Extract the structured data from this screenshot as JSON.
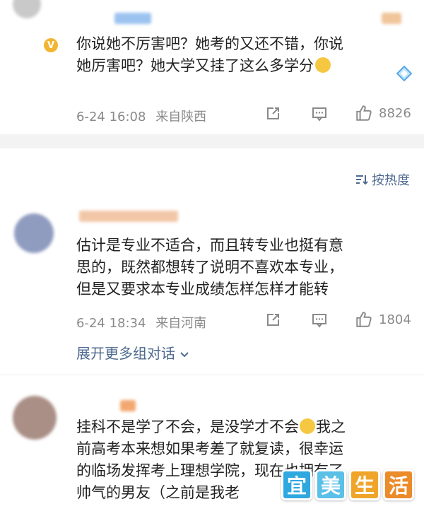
{
  "comments": [
    {
      "lines": [
        "你说她不厉害吧？她考的又还不错，你说",
        "她厉害吧？她大学又挂了这么多学分"
      ],
      "time": "6-24 16:08",
      "location": "来自陕西",
      "likes": "8826"
    },
    {
      "lines": [
        "估计是专业不适合，而且转专业也挺有意",
        "思的，既然都想转了说明不喜欢本专业，",
        "但是又要求本专业成绩怎样怎样才能转"
      ],
      "time": "6-24 18:34",
      "location": "来自河南",
      "likes": "1804",
      "expand": "展开更多组对话"
    },
    {
      "lines": [
        "挂科不是学了不会，是没学才不会",
        "前高考本来想如果考差了就复读，很幸运",
        "的临场发挥考上理想学院，现在也拥有了",
        "帅气的男友（之前是我老"
      ],
      "line1_tail": "我之"
    }
  ],
  "sort": {
    "label": "按热度"
  },
  "watermark": {
    "chars": [
      "宜",
      "美",
      "生",
      "活"
    ]
  },
  "colors": {
    "link": "#4e6a8f",
    "meta": "#8a8a8a",
    "badge": "#f2b531",
    "watermark_bg": [
      "#2fa8e0",
      "#5bc0e8",
      "#f0a52a",
      "#ec8b2a"
    ]
  }
}
